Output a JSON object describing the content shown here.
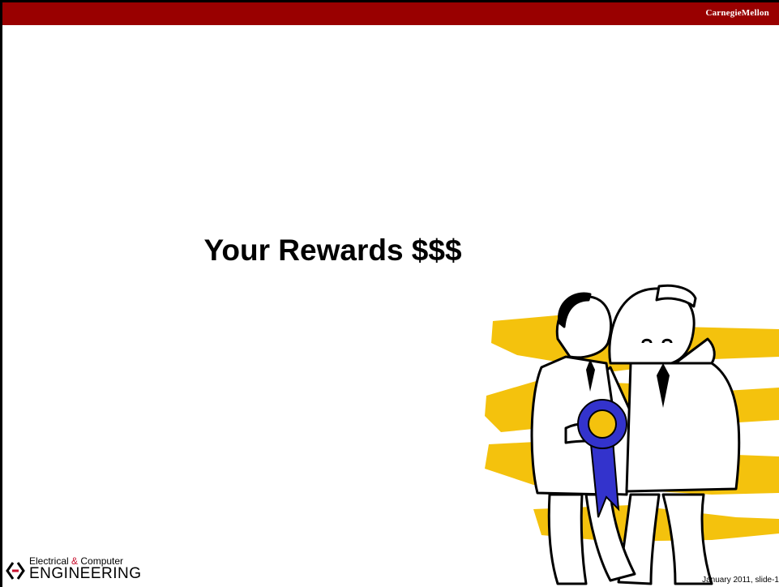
{
  "header": {
    "brand": "CarnegieMellon",
    "bar_color": "#990000"
  },
  "slide": {
    "title": "Your Rewards $$$",
    "illustration": "two-men-award-ribbon-clipart"
  },
  "footer": {
    "logo_line1_a": "Electrical ",
    "logo_line1_amp": "&",
    "logo_line1_b": " Computer",
    "logo_line2": "ENGINEERING",
    "logo_icon": "ece-brackets-logo-icon",
    "slide_info": "January 2011, slide-1"
  }
}
